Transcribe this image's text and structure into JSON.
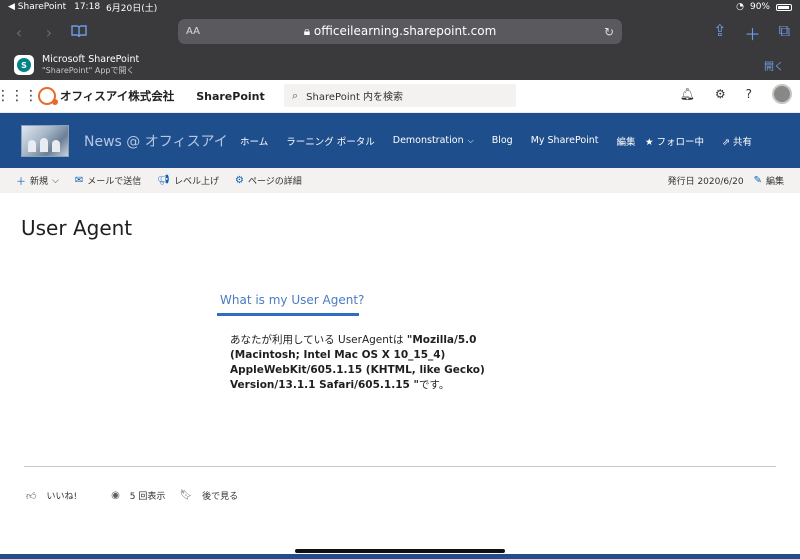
{
  "status_bar": {
    "app_back": "◀ SharePoint",
    "time": "17:18",
    "date": "6月20日(土)",
    "battery": "90%"
  },
  "safari": {
    "text_size": "AA",
    "url": "officeilearning.sharepoint.com"
  },
  "app_banner": {
    "title": "Microsoft SharePoint",
    "subtitle": "\"SharePoint\" Appで開く",
    "open_label": "開く"
  },
  "suite_bar": {
    "org_name": "オフィスアイ株式会社",
    "brand": "SharePoint",
    "search_placeholder": "SharePoint 内を検索"
  },
  "site_header": {
    "title": "News @ オフィスアイ",
    "nav": [
      "ホーム",
      "ラーニング ポータル",
      "Demonstration",
      "Blog",
      "My SharePoint",
      "編集"
    ],
    "follow_label": "フォロー中",
    "share_label": "共有"
  },
  "command_bar": {
    "new_label": "新規",
    "email_label": "メールで送信",
    "promote_label": "レベル上げ",
    "details_label": "ページの詳細",
    "published": "発行日 2020/6/20",
    "edit_label": "編集"
  },
  "page": {
    "title": "User Agent",
    "section_heading": "What is my User Agent?",
    "ua_prefix": "あなたが利用している UserAgentは ",
    "ua_value": "\"Mozilla/5.0 (Macintosh; Intel Mac OS X 10_15_4) AppleWebKit/605.1.15 (KHTML, like Gecko) Version/13.1.1 Safari/605.1.15 \"",
    "ua_suffix": "です。"
  },
  "footer": {
    "like_label": "いいね!",
    "views_label": "5 回表示",
    "save_label": "後で見る"
  },
  "colors": {
    "site_header": "#1f4e8c",
    "accent": "#2f6dc4",
    "chrome": "#3a3a3c"
  }
}
